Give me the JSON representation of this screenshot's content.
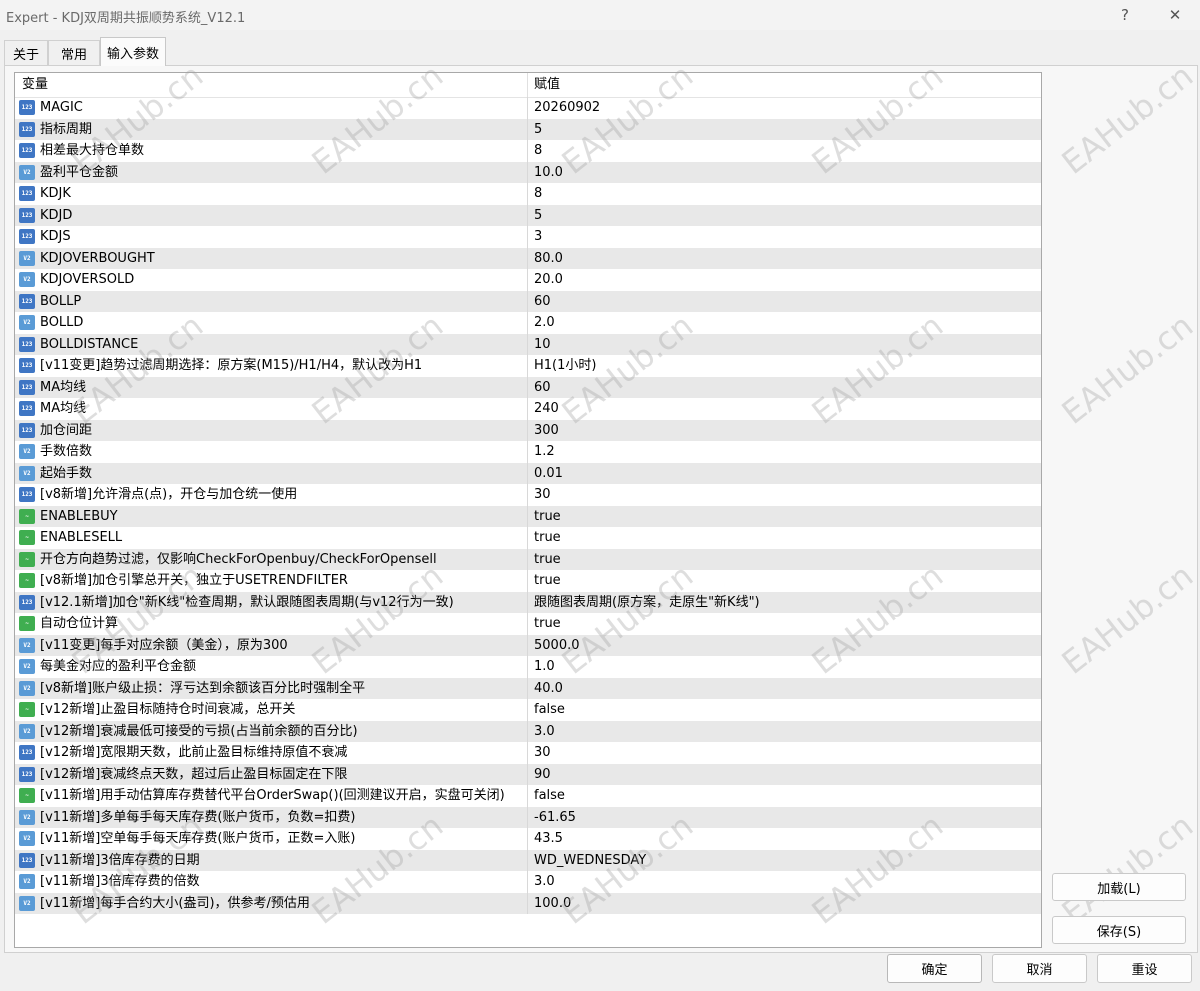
{
  "window": {
    "title": "Expert - KDJ双周期共振顺势系统_V12.1",
    "help_glyph": "?",
    "close_glyph": "✕"
  },
  "tabs": [
    {
      "label": "关于"
    },
    {
      "label": "常用"
    },
    {
      "label": "输入参数"
    }
  ],
  "grid": {
    "header_variable": "变量",
    "header_value": "赋值",
    "rows": [
      {
        "icon": "int",
        "name": "MAGIC",
        "value": "20260902"
      },
      {
        "icon": "int",
        "name": "指标周期",
        "value": "5"
      },
      {
        "icon": "int",
        "name": "相差最大持仓单数",
        "value": "8"
      },
      {
        "icon": "dbl",
        "name": "盈利平仓金额",
        "value": "10.0"
      },
      {
        "icon": "int",
        "name": "KDJK",
        "value": "8"
      },
      {
        "icon": "int",
        "name": "KDJD",
        "value": "5"
      },
      {
        "icon": "int",
        "name": "KDJS",
        "value": "3"
      },
      {
        "icon": "dbl",
        "name": "KDJOVERBOUGHT",
        "value": "80.0"
      },
      {
        "icon": "dbl",
        "name": "KDJOVERSOLD",
        "value": "20.0"
      },
      {
        "icon": "int",
        "name": "BOLLP",
        "value": "60"
      },
      {
        "icon": "dbl",
        "name": "BOLLD",
        "value": "2.0"
      },
      {
        "icon": "int",
        "name": "BOLLDISTANCE",
        "value": "10"
      },
      {
        "icon": "int",
        "name": "[v11变更]趋势过滤周期选择：原方案(M15)/H1/H4，默认改为H1",
        "value": "H1(1小时)"
      },
      {
        "icon": "int",
        "name": "MA均线",
        "value": "60"
      },
      {
        "icon": "int",
        "name": "MA均线",
        "value": "240"
      },
      {
        "icon": "int",
        "name": "加仓间距",
        "value": "300"
      },
      {
        "icon": "dbl",
        "name": "手数倍数",
        "value": "1.2"
      },
      {
        "icon": "dbl",
        "name": "起始手数",
        "value": "0.01"
      },
      {
        "icon": "int",
        "name": "[v8新增]允许滑点(点)，开仓与加仓统一使用",
        "value": "30"
      },
      {
        "icon": "bool",
        "name": "ENABLEBUY",
        "value": "true"
      },
      {
        "icon": "bool",
        "name": "ENABLESELL",
        "value": "true"
      },
      {
        "icon": "bool",
        "name": "开仓方向趋势过滤，仅影响CheckForOpenbuy/CheckForOpensell",
        "value": "true"
      },
      {
        "icon": "bool",
        "name": "[v8新增]加仓引擎总开关，独立于USETRENDFILTER",
        "value": "true"
      },
      {
        "icon": "int",
        "name": "[v12.1新增]加仓\"新K线\"检查周期，默认跟随图表周期(与v12行为一致)",
        "value": "跟随图表周期(原方案，走原生\"新K线\")"
      },
      {
        "icon": "bool",
        "name": "自动仓位计算",
        "value": "true"
      },
      {
        "icon": "dbl",
        "name": "[v11变更]每手对应余额（美金），原为300",
        "value": "5000.0"
      },
      {
        "icon": "dbl",
        "name": "每美金对应的盈利平仓金额",
        "value": "1.0"
      },
      {
        "icon": "dbl",
        "name": "[v8新增]账户级止损：浮亏达到余额该百分比时强制全平",
        "value": "40.0"
      },
      {
        "icon": "bool",
        "name": "[v12新增]止盈目标随持仓时间衰减，总开关",
        "value": "false"
      },
      {
        "icon": "dbl",
        "name": "[v12新增]衰减最低可接受的亏损(占当前余额的百分比)",
        "value": "3.0"
      },
      {
        "icon": "int",
        "name": "[v12新增]宽限期天数，此前止盈目标维持原值不衰减",
        "value": "30"
      },
      {
        "icon": "int",
        "name": "[v12新增]衰减终点天数，超过后止盈目标固定在下限",
        "value": "90"
      },
      {
        "icon": "bool",
        "name": "[v11新增]用手动估算库存费替代平台OrderSwap()(回测建议开启，实盘可关闭)",
        "value": "false"
      },
      {
        "icon": "dbl",
        "name": "[v11新增]多单每手每天库存费(账户货币，负数=扣费)",
        "value": "-61.65"
      },
      {
        "icon": "dbl",
        "name": "[v11新增]空单每手每天库存费(账户货币，正数=入账)",
        "value": "43.5"
      },
      {
        "icon": "int",
        "name": "[v11新增]3倍库存费的日期",
        "value": "WD_WEDNESDAY"
      },
      {
        "icon": "dbl",
        "name": "[v11新增]3倍库存费的倍数",
        "value": "3.0"
      },
      {
        "icon": "dbl",
        "name": "[v11新增]每手合约大小(盎司)，供参考/预估用",
        "value": "100.0"
      }
    ]
  },
  "icon_text": {
    "int": "123",
    "dbl": "V2",
    "bool": "~"
  },
  "buttons": {
    "load": "加载(L)",
    "save": "保存(S)",
    "ok": "确定",
    "cancel": "取消",
    "reset": "重设"
  },
  "watermark": "EAHub.cn"
}
